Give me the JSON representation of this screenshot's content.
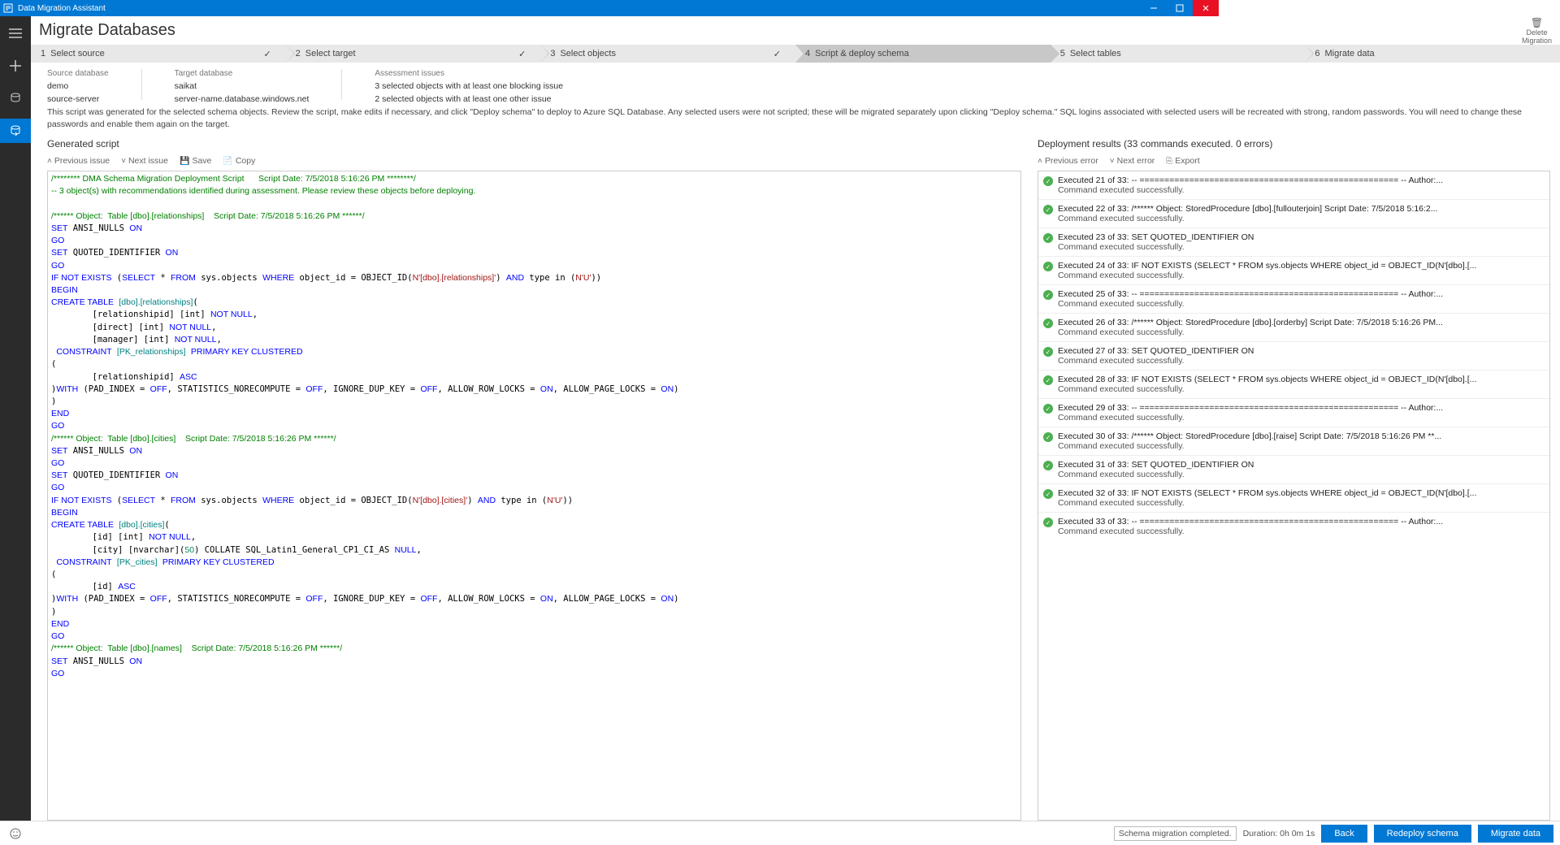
{
  "app": {
    "title": "Data Migration Assistant"
  },
  "page": {
    "title": "Migrate Databases",
    "delete_label": "Delete\nMigration"
  },
  "steps": [
    {
      "num": "1",
      "label": "Select source",
      "done": true
    },
    {
      "num": "2",
      "label": "Select target",
      "done": true
    },
    {
      "num": "3",
      "label": "Select objects",
      "done": true
    },
    {
      "num": "4",
      "label": "Script & deploy schema",
      "active": true
    },
    {
      "num": "5",
      "label": "Select tables"
    },
    {
      "num": "6",
      "label": "Migrate data"
    }
  ],
  "info": {
    "src_db_lbl": "Source database",
    "src_db": "demo",
    "src_srv": "source-server",
    "tgt_db_lbl": "Target database",
    "tgt_db": "saikat",
    "tgt_srv": "server-name.database.windows.net",
    "issues_lbl": "Assessment issues",
    "issues1": "3 selected objects with at least one blocking issue",
    "issues2": "2 selected objects with at least one other issue"
  },
  "desc": "This script was generated for the selected schema objects. Review the script, make edits if necessary, and click \"Deploy schema\" to deploy to Azure SQL Database. Any selected users were not scripted; these will be migrated separately upon clicking \"Deploy schema.\" SQL logins associated with selected users will be recreated with strong, random passwords. You will need to change these passwords and enable them again on the target.",
  "left": {
    "heading": "Generated script",
    "tb_prev": "Previous issue",
    "tb_next": "Next issue",
    "tb_save": "Save",
    "tb_copy": "Copy"
  },
  "right": {
    "heading": "Deployment results (33 commands executed. 0 errors)",
    "tb_prev": "Previous error",
    "tb_next": "Next error",
    "tb_export": "Export"
  },
  "results": [
    {
      "l1": "Executed 21 of 33: -- ==================================================== -- Author:...",
      "l2": "Command executed successfully."
    },
    {
      "l1": "Executed 22 of 33: /****** Object:  StoredProcedure [dbo].[fullouterjoin]    Script Date: 7/5/2018 5:16:2...",
      "l2": "Command executed successfully."
    },
    {
      "l1": "Executed 23 of 33: SET QUOTED_IDENTIFIER ON",
      "l2": "Command executed successfully."
    },
    {
      "l1": "Executed 24 of 33: IF NOT EXISTS (SELECT * FROM sys.objects WHERE object_id = OBJECT_ID(N'[dbo].[...",
      "l2": "Command executed successfully."
    },
    {
      "l1": "Executed 25 of 33: -- ==================================================== -- Author:...",
      "l2": "Command executed successfully."
    },
    {
      "l1": "Executed 26 of 33: /****** Object:  StoredProcedure [dbo].[orderby]    Script Date: 7/5/2018 5:16:26 PM...",
      "l2": "Command executed successfully."
    },
    {
      "l1": "Executed 27 of 33: SET QUOTED_IDENTIFIER ON",
      "l2": "Command executed successfully."
    },
    {
      "l1": "Executed 28 of 33: IF NOT EXISTS (SELECT * FROM sys.objects WHERE object_id = OBJECT_ID(N'[dbo].[...",
      "l2": "Command executed successfully."
    },
    {
      "l1": "Executed 29 of 33: -- ==================================================== -- Author:...",
      "l2": "Command executed successfully."
    },
    {
      "l1": "Executed 30 of 33: /****** Object:  StoredProcedure [dbo].[raise]    Script Date: 7/5/2018 5:16:26 PM **...",
      "l2": "Command executed successfully."
    },
    {
      "l1": "Executed 31 of 33: SET QUOTED_IDENTIFIER ON",
      "l2": "Command executed successfully."
    },
    {
      "l1": "Executed 32 of 33: IF NOT EXISTS (SELECT * FROM sys.objects WHERE object_id = OBJECT_ID(N'[dbo].[...",
      "l2": "Command executed successfully."
    },
    {
      "l1": "Executed 33 of 33: -- ==================================================== -- Author:...",
      "l2": "Command executed successfully."
    }
  ],
  "footer": {
    "status": "Schema migration completed.",
    "duration": "Duration: 0h 0m 1s",
    "back": "Back",
    "redeploy": "Redeploy schema",
    "migrate": "Migrate data"
  }
}
